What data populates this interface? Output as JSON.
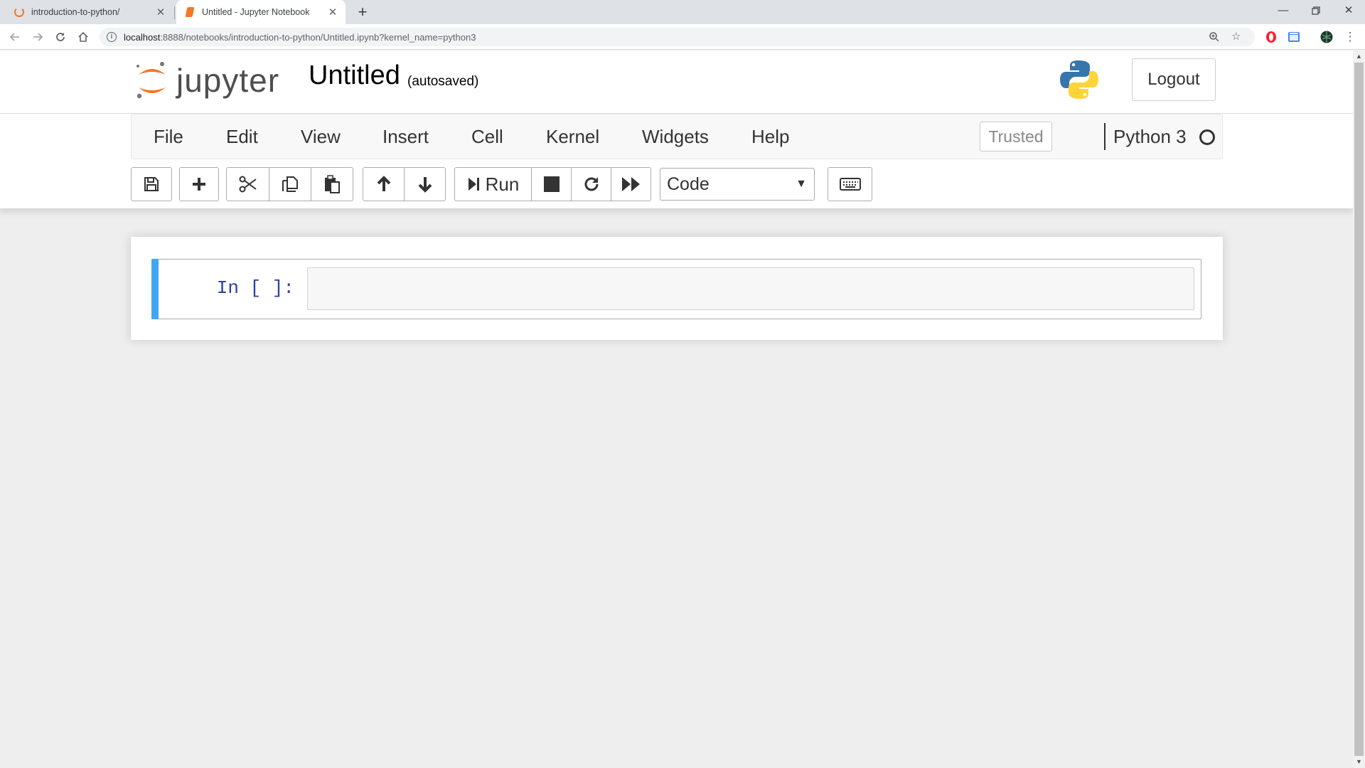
{
  "browser": {
    "tabs": [
      {
        "title": "introduction-to-python/",
        "active": false
      },
      {
        "title": "Untitled - Jupyter Notebook",
        "active": true
      }
    ],
    "address": {
      "host": "localhost",
      "rest": ":8888/notebooks/introduction-to-python/Untitled.ipynb?kernel_name=python3"
    }
  },
  "header": {
    "logo_text": "jupyter",
    "notebook_name": "Untitled",
    "autosave_status": "(autosaved)",
    "logout_label": "Logout"
  },
  "menubar": {
    "items": [
      "File",
      "Edit",
      "View",
      "Insert",
      "Cell",
      "Kernel",
      "Widgets",
      "Help"
    ],
    "trusted_label": "Trusted",
    "kernel_name": "Python 3",
    "kernel_state": "idle"
  },
  "toolbar": {
    "run_label": "Run",
    "cell_type": "Code"
  },
  "cells": [
    {
      "prompt": "In [ ]:",
      "source": ""
    }
  ],
  "colors": {
    "jupyter_orange": "#f37726",
    "cell_accent": "#42a5f5",
    "prompt": "#303f9f"
  }
}
